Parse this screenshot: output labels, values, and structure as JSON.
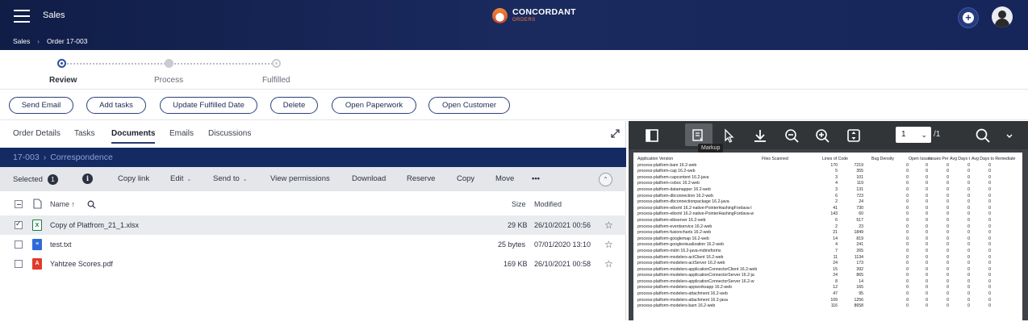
{
  "header": {
    "app_title": "Sales",
    "logo_main": "CONCORDANT",
    "logo_sub": "ORDERS",
    "breadcrumb": [
      "Sales",
      "Order 17-003"
    ],
    "brand_color": "#16255a",
    "accent_color": "#f07e3a"
  },
  "steps": [
    {
      "label": "Review",
      "state": "active"
    },
    {
      "label": "Process",
      "state": "next"
    },
    {
      "label": "Fulfilled",
      "state": "later"
    }
  ],
  "actions": [
    "Send Email",
    "Add tasks",
    "Update Fulfilled Date",
    "Delete",
    "Open Paperwork",
    "Open Customer"
  ],
  "tabs": [
    "Order Details",
    "Tasks",
    "Documents",
    "Emails",
    "Discussions"
  ],
  "active_tab": "Documents",
  "folder_path": [
    "17-003",
    "Correspondence"
  ],
  "toolbar": {
    "selected_label": "Selected",
    "selected_count": "1",
    "info_icon": "i",
    "copy_link": "Copy link",
    "edit": "Edit",
    "send_to": "Send to",
    "view_permissions": "View permissions",
    "download": "Download",
    "reserve": "Reserve",
    "copy": "Copy",
    "move": "Move",
    "more": "•••"
  },
  "columns": {
    "name": "Name",
    "size": "Size",
    "modified": "Modified"
  },
  "files": [
    {
      "name": "Copy of Platfrom_21_1.xlsx",
      "type": "xlsx",
      "badge": "X",
      "size": "29 KB",
      "modified": "26/10/2021 00:56",
      "selected": true
    },
    {
      "name": "test.txt",
      "type": "txt",
      "badge": "≡",
      "size": "25 bytes",
      "modified": "07/01/2020 13:10",
      "selected": false
    },
    {
      "name": "Yahtzee Scores.pdf",
      "type": "pdf",
      "badge": "A",
      "size": "169 KB",
      "modified": "26/10/2021 00:58",
      "selected": false
    }
  ],
  "viewer": {
    "tooltip": "Markup",
    "page_current": "1",
    "page_total": "/1",
    "table_headers": [
      "Application Version",
      "Files Scanned",
      "Lines of Code",
      "Bug Density",
      "Open Issues",
      "Issues Per",
      "Avg Days t",
      "Avg Days to Remediate"
    ],
    "table_rows": [
      [
        "process-platform-bam 16.2-web",
        "170",
        "7219",
        "0",
        "0",
        "0",
        "0",
        "0"
      ],
      [
        "process-platform-cap 16.2-web",
        "5",
        "355",
        "0",
        "0",
        "0",
        "0",
        "0"
      ],
      [
        "process-platform-capcontent 16.2-java",
        "3",
        "101",
        "0",
        "0",
        "0",
        "0",
        "0"
      ],
      [
        "process-platform-coboc 16.2-web",
        "4",
        "119",
        "0",
        "0",
        "0",
        "0",
        "0"
      ],
      [
        "process-platform-datamapper 16.2-web",
        "3",
        "131",
        "0",
        "0",
        "0",
        "0",
        "0"
      ],
      [
        "process-platform-dbconnection 16.2-web",
        "6",
        "723",
        "0",
        "0",
        "0",
        "0",
        "0"
      ],
      [
        "process-platform-dbconnectionpackage 16.2-java",
        "2",
        "24",
        "0",
        "0",
        "0",
        "0",
        "0"
      ],
      [
        "process-platform-eibxml 16.2-native-PointerHashingFordava-l",
        "41",
        "730",
        "0",
        "0",
        "0",
        "0",
        "0"
      ],
      [
        "process-platform-eibxml 16.2-native-PointerHashingFordava-w",
        "143",
        "60",
        "0",
        "0",
        "0",
        "0",
        "0"
      ],
      [
        "process-platform-eibserver 16.2-web",
        "6",
        "517",
        "0",
        "0",
        "0",
        "0",
        "0"
      ],
      [
        "process-platform-eventservice 16.2-web",
        "2",
        "23",
        "0",
        "0",
        "0",
        "0",
        "0"
      ],
      [
        "process-platform-fusioncharts 16.2-web",
        "21",
        "1849",
        "0",
        "0",
        "0",
        "0",
        "0"
      ],
      [
        "process-platform-googlemap 16.2-web",
        "14",
        "819",
        "0",
        "0",
        "0",
        "0",
        "0"
      ],
      [
        "process-platform-googlevisualization 16.2-web",
        "4",
        "241",
        "0",
        "0",
        "0",
        "0",
        "0"
      ],
      [
        "process-platform-mdm 16.2-java-mdmxforms",
        "7",
        "265",
        "0",
        "0",
        "0",
        "0",
        "0"
      ],
      [
        "process-platform-modelers-actClient 16.2-web",
        "11",
        "1134",
        "0",
        "0",
        "0",
        "0",
        "0"
      ],
      [
        "process-platform-modelers-actServer 16.2-web",
        "24",
        "173",
        "0",
        "0",
        "0",
        "0",
        "0"
      ],
      [
        "process-platform-modelers-applicationConnectorClient 16.2-web",
        "15",
        "392",
        "0",
        "0",
        "0",
        "0",
        "0"
      ],
      [
        "process-platform-modelers-applicationConnectorServer 16.2-ja",
        "24",
        "865",
        "0",
        "0",
        "0",
        "0",
        "0"
      ],
      [
        "process-platform-modelers-applicationConnectorServer 16.2-w",
        "8",
        "14",
        "0",
        "0",
        "0",
        "0",
        "0"
      ],
      [
        "process-platform-modelers-appworksapp 16.2-web",
        "12",
        "165",
        "0",
        "0",
        "0",
        "0",
        "0"
      ],
      [
        "process-platform-modelers-attachment 16.2-web",
        "47",
        "95",
        "0",
        "0",
        "0",
        "0",
        "0"
      ],
      [
        "process-platform-modelers-attachment 16.2-java",
        "109",
        "1256",
        "0",
        "0",
        "0",
        "0",
        "0"
      ],
      [
        "process-platform-modelers-bam 16.2-web",
        "116",
        "8658",
        "0",
        "0",
        "0",
        "0",
        "0"
      ]
    ]
  }
}
